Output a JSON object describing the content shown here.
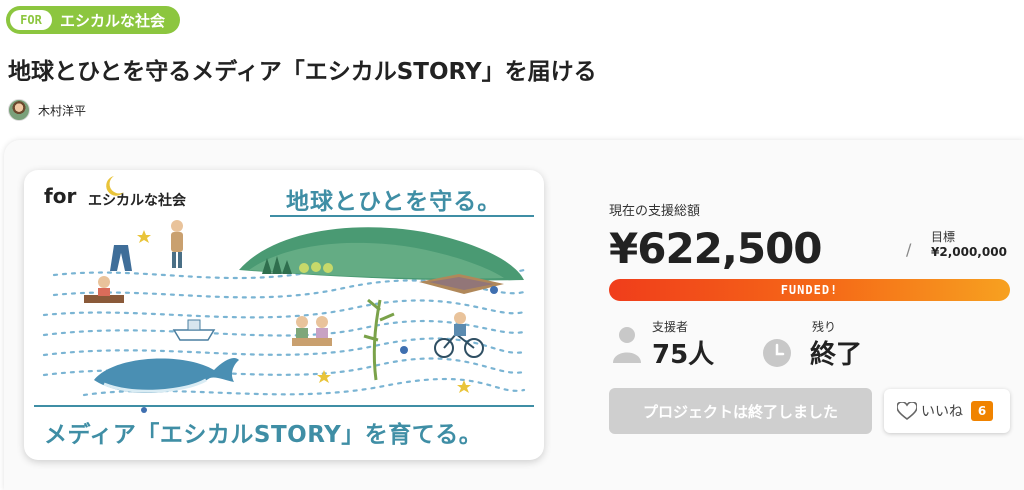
{
  "category_tag": {
    "prefix": "FOR",
    "label": "エシカルな社会"
  },
  "project": {
    "title": "地球とひとを守るメディア「エシカルSTORY」を届ける",
    "owner": "木村洋平"
  },
  "hero_image": {
    "brand_for": "for",
    "brand_label": "エシカルな社会",
    "headline_top": "地球とひとを守る。",
    "headline_bottom": "メディア「エシカルSTORY」を育てる。"
  },
  "stats": {
    "total_label": "現在の支援総額",
    "total_value": "¥622,500",
    "separator": "/",
    "goal_label": "目標",
    "goal_value": "¥2,000,000",
    "funded_label": "FUNDED!",
    "supporters_label": "支援者",
    "supporters_value": "75人",
    "remaining_label": "残り",
    "remaining_value": "終了"
  },
  "actions": {
    "ended_button_label": "プロジェクトは終了しました",
    "like_label": "いいね",
    "like_count": "6"
  },
  "colors": {
    "tag_green": "#8cc63f",
    "funded_start": "#f03d1b",
    "funded_end": "#f7a120",
    "like_badge": "#f08300",
    "hero_teal": "#3f8ea5",
    "hero_text_dark": "#2a5b6b"
  }
}
